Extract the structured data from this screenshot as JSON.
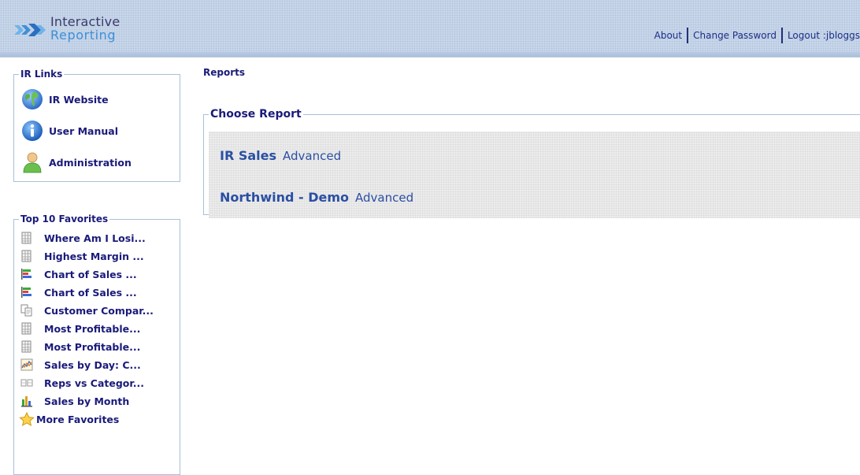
{
  "header": {
    "logo_line1": "Interactive",
    "logo_line2": "Reporting",
    "nav": {
      "about": "About",
      "change_password": "Change Password",
      "logout": "Logout :jbloggs"
    }
  },
  "sidebar": {
    "ir_links": {
      "title": "IR Links",
      "items": [
        {
          "label": "IR Website",
          "icon": "globe-icon"
        },
        {
          "label": "User Manual",
          "icon": "info-icon"
        },
        {
          "label": "Administration",
          "icon": "user-icon"
        }
      ]
    },
    "favorites": {
      "title": "Top 10 Favorites",
      "items": [
        {
          "label": "Where Am I Losi...",
          "icon": "grid-report-icon"
        },
        {
          "label": "Highest Margin ...",
          "icon": "grid-report-icon"
        },
        {
          "label": "Chart of Sales ...",
          "icon": "bar-chart-icon"
        },
        {
          "label": "Chart of Sales ...",
          "icon": "bar-chart-icon"
        },
        {
          "label": "Customer Compar...",
          "icon": "documents-icon"
        },
        {
          "label": "Most Profitable...",
          "icon": "grid-report-icon"
        },
        {
          "label": "Most Profitable...",
          "icon": "grid-report-icon"
        },
        {
          "label": "Sales by Day: C...",
          "icon": "line-chart-icon"
        },
        {
          "label": "Reps vs Categor...",
          "icon": "crosstab-icon"
        },
        {
          "label": "Sales by Month",
          "icon": "column-chart-icon"
        }
      ],
      "more": {
        "label": "More Favorites",
        "icon": "star-icon"
      }
    }
  },
  "main": {
    "title": "Reports",
    "choose_report": {
      "title": "Choose Report",
      "reports": [
        {
          "name": "IR Sales",
          "link": "Advanced"
        },
        {
          "name": "Northwind - Demo",
          "link": "Advanced"
        }
      ]
    }
  },
  "colors": {
    "header_bg": "#c9d7ea",
    "link_text": "#1a1a7a",
    "report_text": "#2a4fa3",
    "panel_border": "#a7c0dc"
  }
}
